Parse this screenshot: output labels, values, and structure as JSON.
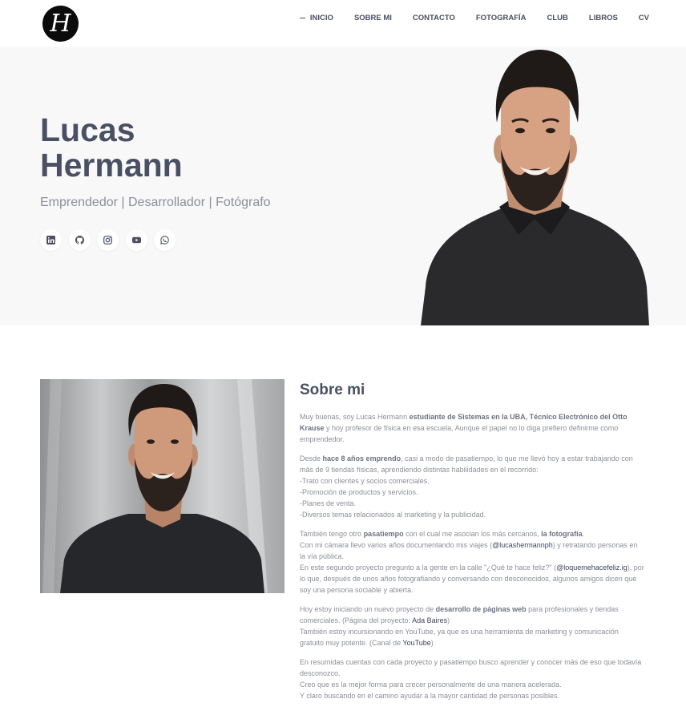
{
  "logo": {
    "letter": "H"
  },
  "nav": {
    "items": [
      {
        "label": "INICIO",
        "active": true
      },
      {
        "label": "SOBRE MI"
      },
      {
        "label": "CONTACTO"
      },
      {
        "label": "FOTOGRAFÍA"
      },
      {
        "label": "CLUB"
      },
      {
        "label": "LIBROS"
      },
      {
        "label": "CV"
      }
    ]
  },
  "hero": {
    "first_name": "Lucas",
    "last_name": "Hermann",
    "subtitle": "Emprendedor | Desarrollador | Fotógrafo",
    "socials": [
      "linkedin-icon",
      "github-icon",
      "instagram-icon",
      "youtube-icon",
      "whatsapp-icon"
    ]
  },
  "about": {
    "title": "Sobre mi",
    "p1": {
      "t1": "Muy buenas, soy Lucas Hermann ",
      "b1": "estudiante de Sistemas en la UBA, Técnico Electrónico del Otto Krause",
      "t2": " y hoy profesor de física en esa escuela. Aunque el papel no lo diga prefiero definirme como emprendedor."
    },
    "p2": {
      "t1": "Desde ",
      "b1": "hace 8 años emprendo",
      "t2": ", casi a modo de pasatiempo, lo que me llevó hoy a estar trabajando con más de 9 tiendas físicas, aprendiendo distintas habilidades en el recorrido:",
      "l1": "-Trato con clientes y socios comerciales.",
      "l2": "-Promoción de productos y servicios.",
      "l3": "-Planes de venta.",
      "l4": "-Diversos temas relacionados al marketing y la publicidad."
    },
    "p3": {
      "t1": "También tengo otro ",
      "b1": "pasatiempo",
      "t2": " con el cual me asocian los más cercanos, ",
      "b2": "la fotografía",
      "t3": ".",
      "t4": "Con mi cámara llevo varios años documentando mis viajes (",
      "a1": "@lucashermannph",
      "t5": ") y retratando personas en la vía pública.",
      "t6": "En este segundo proyecto pregunto a la gente en la calle \"¿Qué te hace feliz?\" (",
      "a2": "@loquemehacefeliz.ig",
      "t7": "), por lo que, después de unos años fotografiando y conversando con desconocidos, algunos amigos dicen que soy una persona sociable y abierta."
    },
    "p4": {
      "t1": "Hoy estoy iniciando un nuevo proyecto de ",
      "b1": "desarrollo de páginas web",
      "t2": " para profesionales y tiendas comerciales. (Página del proyecto: ",
      "a1": "Ada Baires",
      "t3": ")",
      "t4": "También estoy incursionando en YouTube, ya que es una herramienta de marketing y comunicación gratuito muy potente. (Canal de ",
      "a2": "YouTube",
      "t5": ")"
    },
    "p5": {
      "l1": "En resumidas cuentas con cada proyecto y pasatiempo busco aprender y conocer más de eso que todavía desconozco.",
      "l2": "Creo que es la mejor forma para crecer personalmente de una manera acelerada.",
      "l3": "Y claro buscando en el camino ayudar a la mayor cantidad de personas posibles."
    }
  }
}
